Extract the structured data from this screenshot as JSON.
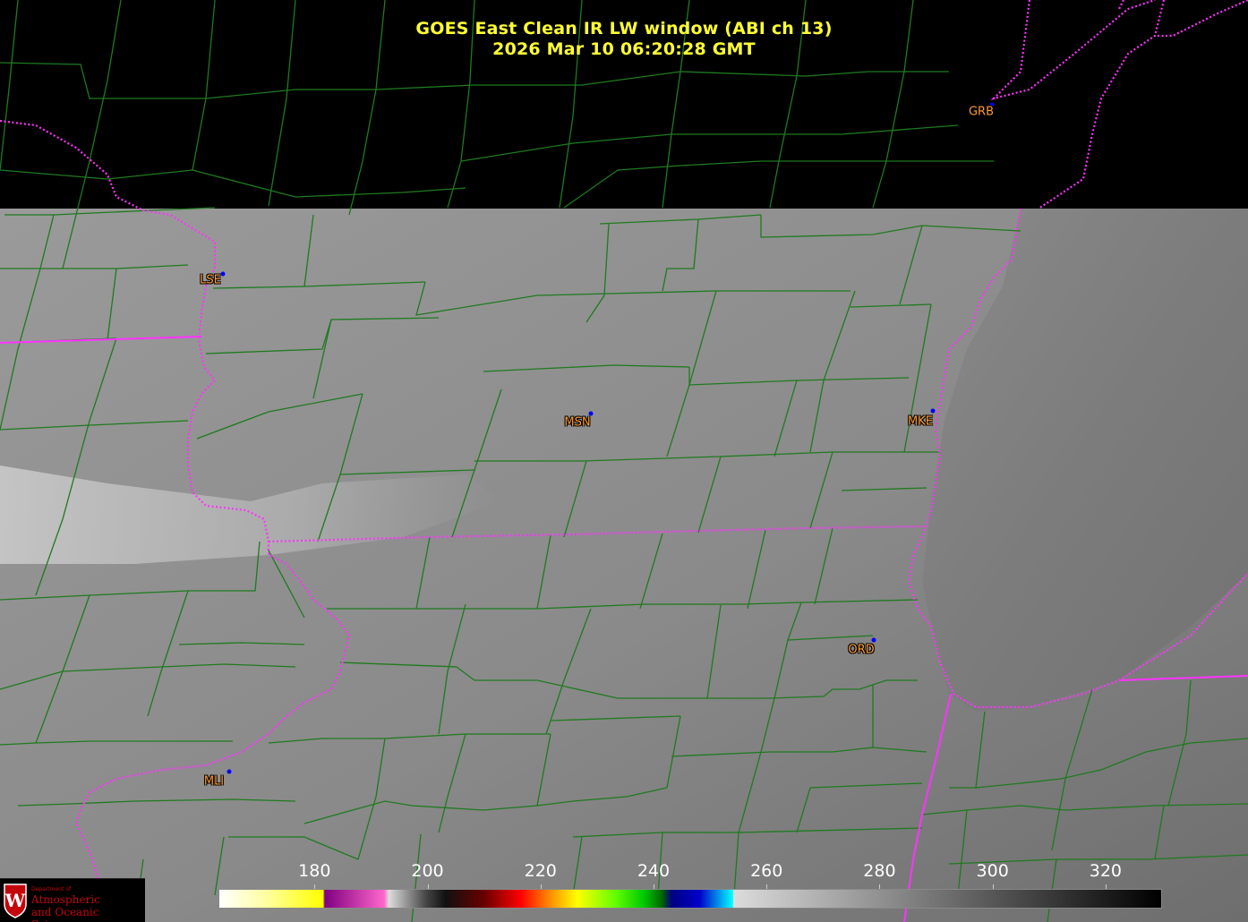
{
  "title": {
    "line1": "GOES East Clean IR LW window (ABI ch 13)",
    "line2": "2026 Mar 10  06:20:28 GMT",
    "color": "#ffff33"
  },
  "stations": [
    {
      "id": "GRB",
      "label": "GRB"
    },
    {
      "id": "LSE",
      "label": "LSE"
    },
    {
      "id": "MSN",
      "label": "MSN"
    },
    {
      "id": "MKE",
      "label": "MKE"
    },
    {
      "id": "ORD",
      "label": "ORD"
    },
    {
      "id": "MLI",
      "label": "MLI"
    }
  ],
  "station_label_color": "#ff9933",
  "station_dot_color": "#0000ff",
  "colorbar": {
    "ticks": [
      "180",
      "200",
      "220",
      "240",
      "260",
      "280",
      "300",
      "320"
    ],
    "min_value": 163,
    "max_value": 330
  },
  "map_colors": {
    "background": "#000000",
    "county_lines": "#1f7a1f",
    "state_borders": "#ff33ff"
  },
  "logo": {
    "dept_text": "Department of",
    "name_line1": "Atmospheric",
    "name_line2": "and Oceanic Sciences",
    "seal_letter": "W"
  }
}
